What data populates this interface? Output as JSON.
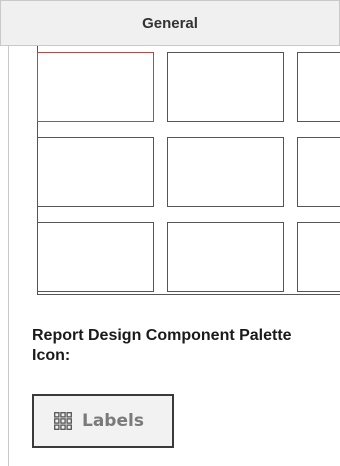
{
  "header": {
    "title": "General"
  },
  "grid": {
    "rows": 3,
    "cols": 3,
    "selected_cell": {
      "row": 0,
      "col": 0
    }
  },
  "caption": {
    "text": "Report Design Component Palette Icon:"
  },
  "palette_button": {
    "icon": "grid-icon",
    "label": "Labels"
  },
  "colors": {
    "header_bg": "#f0f0f0",
    "selected_border": "#b34a4a",
    "box_border": "#555555",
    "button_text": "#7a7a7a"
  }
}
